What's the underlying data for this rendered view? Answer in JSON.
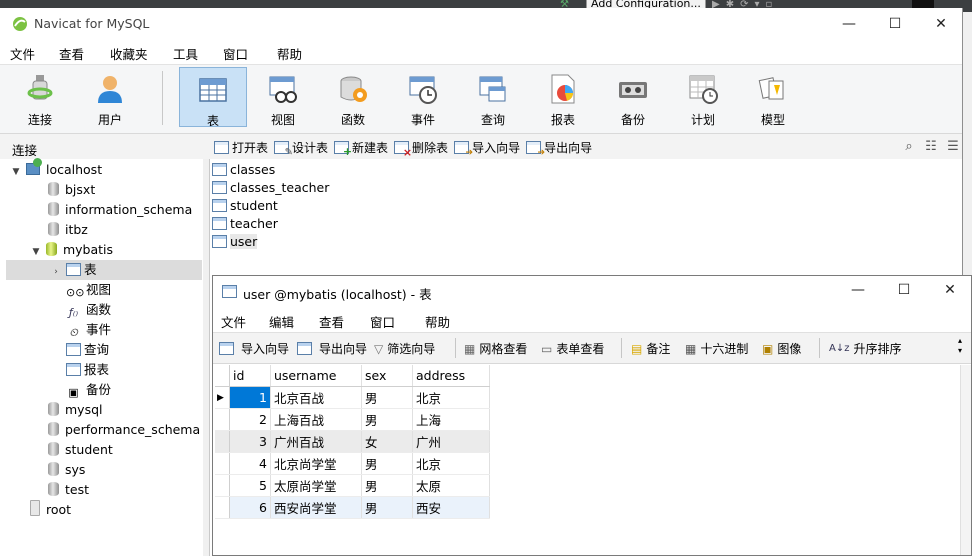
{
  "backdrop": {
    "config_label": "Add Configuration..."
  },
  "window": {
    "title": "Navicat for MySQL",
    "controls": {
      "minimize": "—",
      "maximize": "☐",
      "close": "✕"
    }
  },
  "menu": [
    "文件",
    "查看",
    "收藏夹",
    "工具",
    "窗口",
    "帮助"
  ],
  "toolbar": [
    {
      "label": "连接",
      "icon": "plug-icon"
    },
    {
      "label": "用户",
      "icon": "user-icon"
    },
    {
      "label": "表",
      "icon": "table-icon",
      "active": true
    },
    {
      "label": "视图",
      "icon": "view-icon"
    },
    {
      "label": "函数",
      "icon": "function-icon"
    },
    {
      "label": "事件",
      "icon": "event-clock-icon"
    },
    {
      "label": "查询",
      "icon": "query-icon"
    },
    {
      "label": "报表",
      "icon": "report-icon"
    },
    {
      "label": "备份",
      "icon": "backup-icon"
    },
    {
      "label": "计划",
      "icon": "schedule-icon"
    },
    {
      "label": "模型",
      "icon": "model-icon"
    }
  ],
  "subbar": {
    "connection_label": "连接",
    "actions": [
      "打开表",
      "设计表",
      "新建表",
      "删除表",
      "导入向导",
      "导出向导"
    ]
  },
  "tree": {
    "items": [
      {
        "label": "localhost",
        "type": "host",
        "expanded": true
      },
      {
        "label": "bjsxt",
        "type": "db"
      },
      {
        "label": "information_schema",
        "type": "db"
      },
      {
        "label": "itbz",
        "type": "db"
      },
      {
        "label": "mybatis",
        "type": "db-open",
        "expanded": true
      },
      {
        "label": "表",
        "type": "tables",
        "selected": true
      },
      {
        "label": "视图",
        "type": "views"
      },
      {
        "label": "函数",
        "type": "functions"
      },
      {
        "label": "事件",
        "type": "events"
      },
      {
        "label": "查询",
        "type": "queries"
      },
      {
        "label": "报表",
        "type": "reports"
      },
      {
        "label": "备份",
        "type": "backups"
      },
      {
        "label": "mysql",
        "type": "db"
      },
      {
        "label": "performance_schema",
        "type": "db"
      },
      {
        "label": "student",
        "type": "db"
      },
      {
        "label": "sys",
        "type": "db"
      },
      {
        "label": "test",
        "type": "db"
      },
      {
        "label": "root",
        "type": "conn"
      }
    ]
  },
  "objects": [
    "classes",
    "classes_teacher",
    "student",
    "teacher",
    "user"
  ],
  "child": {
    "title": "user @mybatis (localhost) - 表",
    "menu": [
      "文件",
      "编辑",
      "查看",
      "窗口",
      "帮助"
    ],
    "tools": [
      "导入向导",
      "导出向导",
      "筛选向导",
      "网格查看",
      "表单查看",
      "备注",
      "十六进制",
      "图像",
      "升序排序"
    ],
    "columns": [
      "id",
      "username",
      "sex",
      "address"
    ],
    "rows": [
      [
        "1",
        "北京百战",
        "男",
        "北京"
      ],
      [
        "2",
        "上海百战",
        "男",
        "上海"
      ],
      [
        "3",
        "广州百战",
        "女",
        "广州"
      ],
      [
        "4",
        "北京尚学堂",
        "男",
        "北京"
      ],
      [
        "5",
        "太原尚学堂",
        "男",
        "太原"
      ],
      [
        "6",
        "西安尚学堂",
        "男",
        "西安"
      ]
    ]
  }
}
